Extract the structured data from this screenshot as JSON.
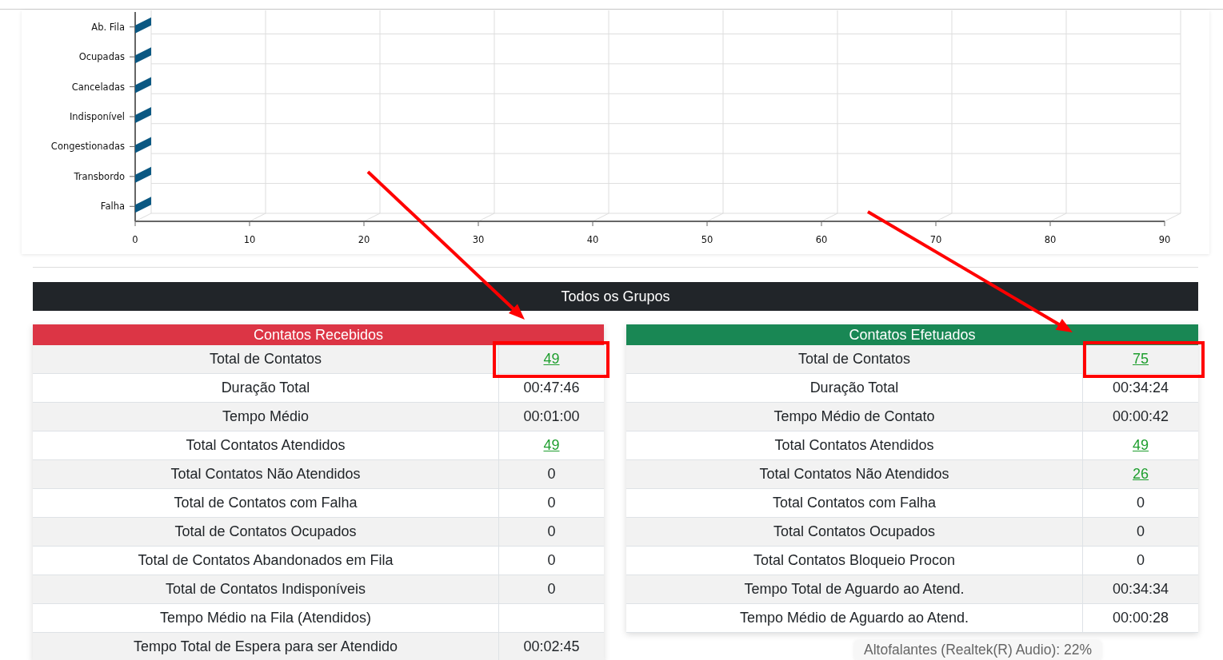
{
  "chart": {
    "chart_data": {
      "type": "bar",
      "orientation": "horizontal",
      "categories": [
        "Ab. Fila",
        "Ocupadas",
        "Canceladas",
        "Indisponível",
        "Congestionadas",
        "Transbordo",
        "Falha"
      ],
      "values": [
        0,
        0,
        0,
        0,
        0,
        0,
        0
      ],
      "xlim": [
        0,
        90
      ],
      "xticks": [
        0,
        10,
        20,
        30,
        40,
        50,
        60,
        70,
        80,
        90
      ]
    }
  },
  "section_title": "Todos os Grupos",
  "tables": [
    {
      "title": "Contatos Recebidos",
      "color": "#dc3545",
      "rows": [
        {
          "label": "Total de Contatos",
          "value": "49",
          "link": true
        },
        {
          "label": "Duração Total",
          "value": "00:47:46",
          "link": false
        },
        {
          "label": "Tempo Médio",
          "value": "00:01:00",
          "link": false
        },
        {
          "label": "Total Contatos Atendidos",
          "value": "49",
          "link": true
        },
        {
          "label": "Total Contatos Não Atendidos",
          "value": "0",
          "link": false
        },
        {
          "label": "Total de Contatos com Falha",
          "value": "0",
          "link": false
        },
        {
          "label": "Total de Contatos Ocupados",
          "value": "0",
          "link": false
        },
        {
          "label": "Total de Contatos Abandonados em Fila",
          "value": "0",
          "link": false
        },
        {
          "label": "Total de Contatos Indisponíveis",
          "value": "0",
          "link": false
        },
        {
          "label": "Tempo Médio na Fila (Atendidos)",
          "link": false
        },
        {
          "label": "Tempo Total de Espera para ser Atendido",
          "value": "00:02:45",
          "link": false
        }
      ]
    },
    {
      "title": "Contatos Efetuados",
      "color": "#198754",
      "rows": [
        {
          "label": "Total de Contatos",
          "value": "75",
          "link": true
        },
        {
          "label": "Duração Total",
          "value": "00:34:24",
          "link": false
        },
        {
          "label": "Tempo Médio de Contato",
          "value": "00:00:42",
          "link": false
        },
        {
          "label": "Total Contatos Atendidos",
          "value": "49",
          "link": true
        },
        {
          "label": "Total Contatos Não Atendidos",
          "value": "26",
          "link": true
        },
        {
          "label": "Total Contatos com Falha",
          "value": "0",
          "link": false
        },
        {
          "label": "Total Contatos Ocupados",
          "value": "0",
          "link": false
        },
        {
          "label": "Total Contatos Bloqueio Procon",
          "value": "0",
          "link": false
        },
        {
          "label": "Tempo Total de Aguardo ao Atend.",
          "value": "00:34:34",
          "link": false
        },
        {
          "label": "Tempo Médio de Aguardo ao Atend.",
          "value": "00:00:28",
          "link": false
        }
      ]
    }
  ],
  "tooltip": "Altofalantes (Realtek(R) Audio): 22%",
  "markup": [
    {
      "kind": "arrow"
    },
    {
      "kind": "arrow"
    },
    {
      "kind": "frame"
    },
    {
      "kind": "frame"
    }
  ]
}
